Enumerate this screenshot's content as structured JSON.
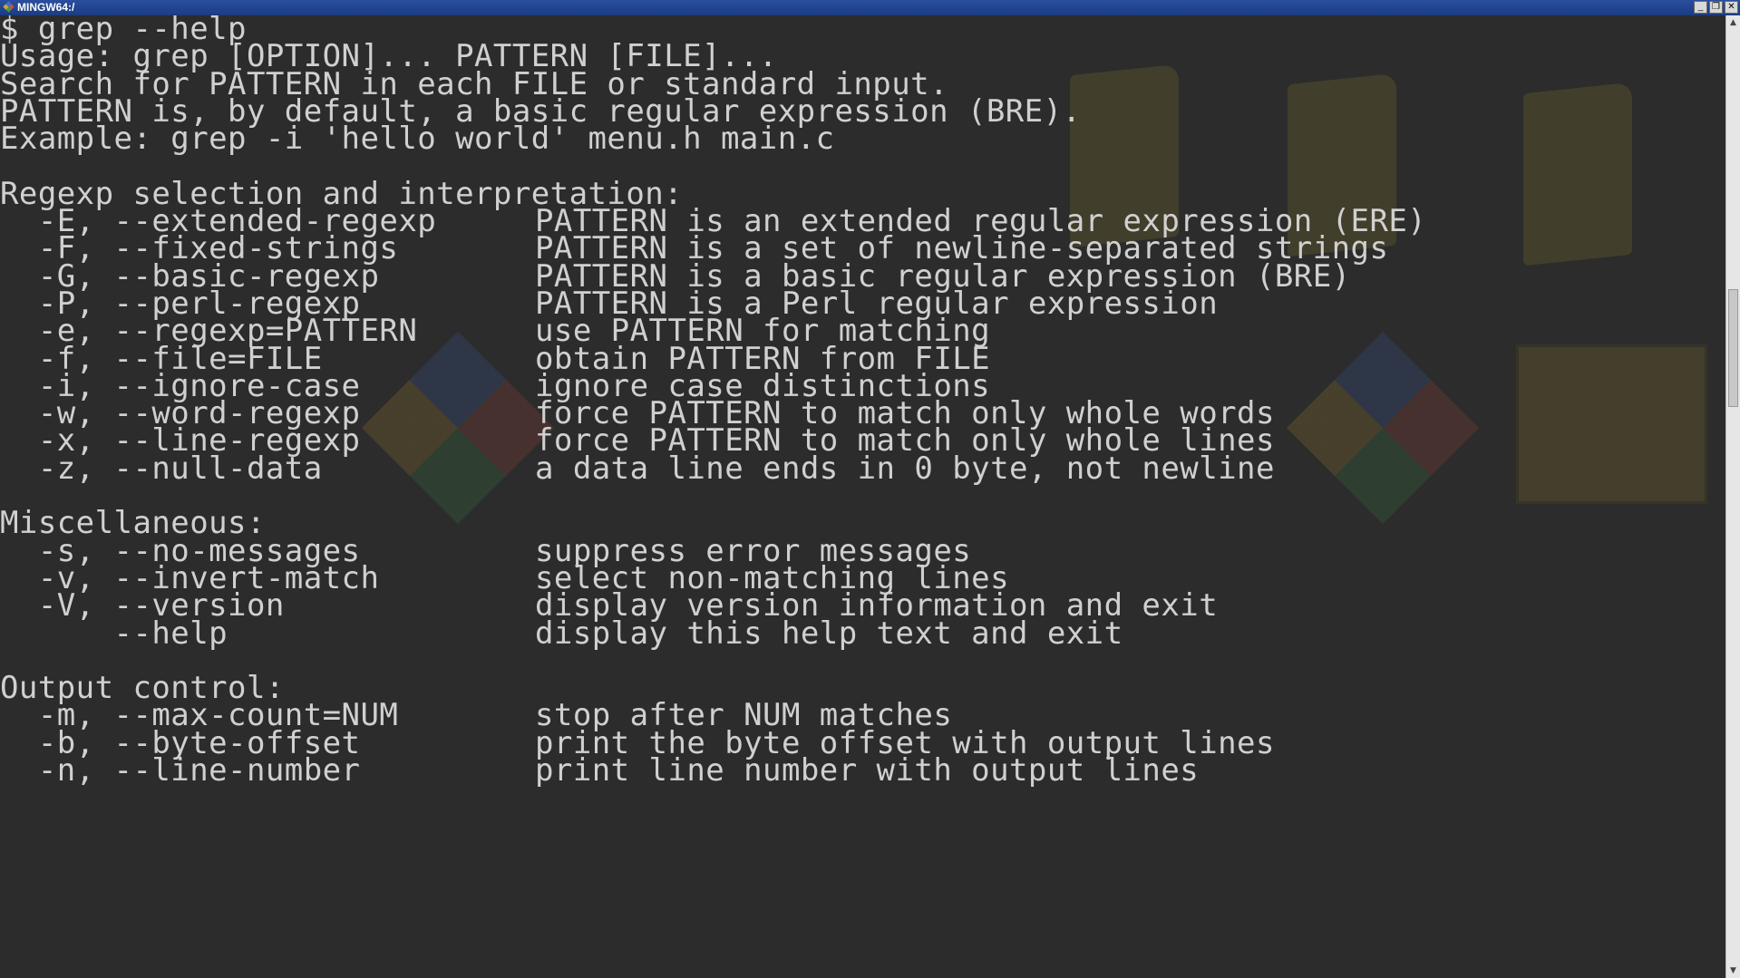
{
  "window": {
    "title": "MINGW64:/",
    "controls": [
      "minimize-icon",
      "restore-icon",
      "close-icon"
    ]
  },
  "terminal": {
    "lines": [
      {
        "text": "$ grep --help"
      },
      {
        "text": "Usage: grep [OPTION]... PATTERN [FILE]..."
      },
      {
        "text": "Search for PATTERN in each FILE or standard input."
      },
      {
        "text": "PATTERN is, by default, a basic regular expression (BRE)."
      },
      {
        "text": "Example: grep -i 'hello world' menu.h main.c"
      },
      {
        "text": ""
      },
      {
        "text": "Regexp selection and interpretation:"
      },
      {
        "opt": "  -E, --extended-regexp",
        "desc": "PATTERN is an extended regular expression (ERE)"
      },
      {
        "opt": "  -F, --fixed-strings",
        "desc": "PATTERN is a set of newline-separated strings"
      },
      {
        "opt": "  -G, --basic-regexp",
        "desc": "PATTERN is a basic regular expression (BRE)"
      },
      {
        "opt": "  -P, --perl-regexp",
        "desc": "PATTERN is a Perl regular expression"
      },
      {
        "opt": "  -e, --regexp=PATTERN",
        "desc": "use PATTERN for matching"
      },
      {
        "opt": "  -f, --file=FILE",
        "desc": "obtain PATTERN from FILE"
      },
      {
        "opt": "  -i, --ignore-case",
        "desc": "ignore case distinctions"
      },
      {
        "opt": "  -w, --word-regexp",
        "desc": "force PATTERN to match only whole words"
      },
      {
        "opt": "  -x, --line-regexp",
        "desc": "force PATTERN to match only whole lines"
      },
      {
        "opt": "  -z, --null-data",
        "desc": "a data line ends in 0 byte, not newline"
      },
      {
        "text": ""
      },
      {
        "text": "Miscellaneous:"
      },
      {
        "opt": "  -s, --no-messages",
        "desc": "suppress error messages"
      },
      {
        "opt": "  -v, --invert-match",
        "desc": "select non-matching lines"
      },
      {
        "opt": "  -V, --version",
        "desc": "display version information and exit"
      },
      {
        "opt": "      --help",
        "desc": "display this help text and exit"
      },
      {
        "text": ""
      },
      {
        "text": "Output control:"
      },
      {
        "opt": "  -m, --max-count=NUM",
        "desc": "stop after NUM matches"
      },
      {
        "opt": "  -b, --byte-offset",
        "desc": "print the byte offset with output lines"
      },
      {
        "opt": "  -n, --line-number",
        "desc": "print line number with output lines"
      }
    ]
  },
  "colors": {
    "terminal_bg": "#2c2c2c",
    "terminal_fg": "#d0d0d0",
    "titlebar": "#1c3b82"
  }
}
